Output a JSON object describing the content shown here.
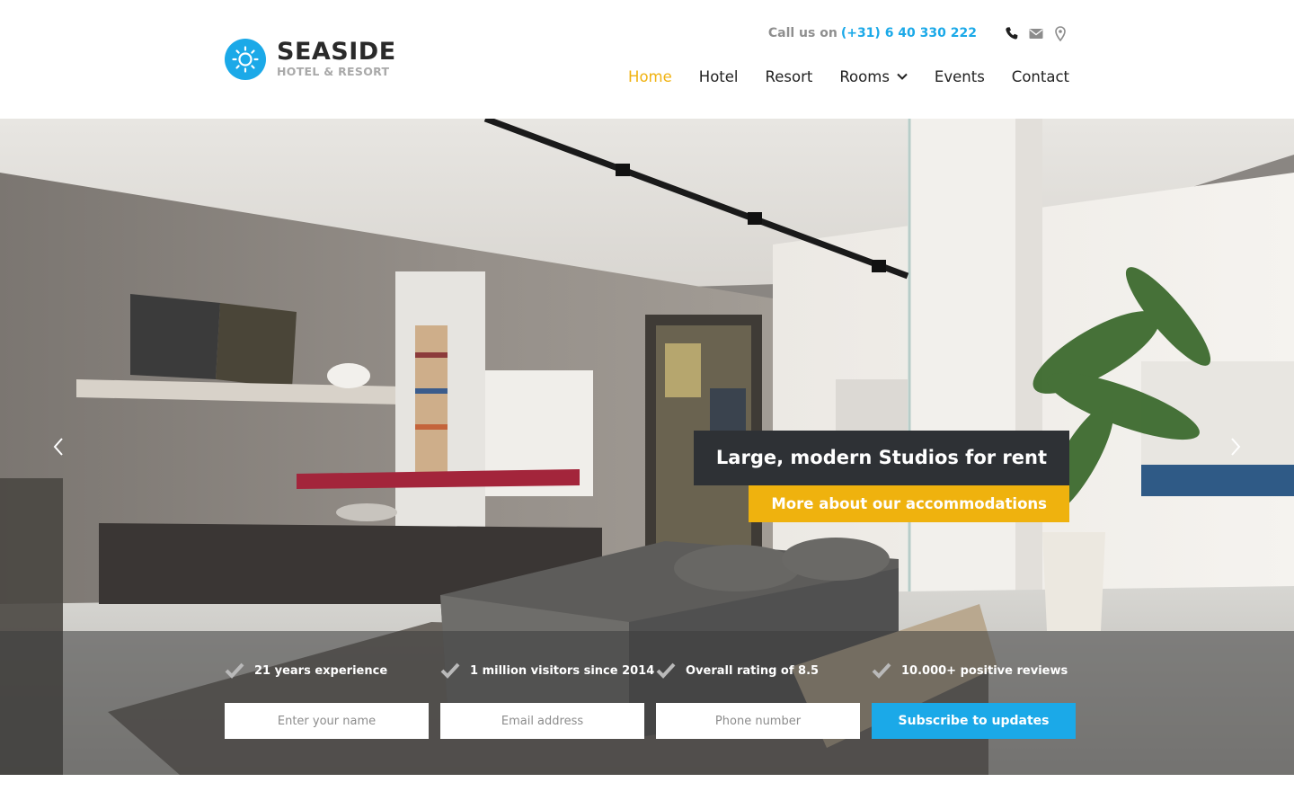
{
  "brand": {
    "name": "SEASIDE",
    "tagline": "HOTEL & RESORT",
    "accent_color": "#1ba9e8",
    "highlight_color": "#f0b210"
  },
  "contact": {
    "label": "Call us on",
    "phone": "(+31) 6 40 330 222",
    "icons": [
      "phone-icon",
      "envelope-icon",
      "map-pin-icon"
    ]
  },
  "nav": {
    "items": [
      {
        "label": "Home",
        "active": true
      },
      {
        "label": "Hotel",
        "active": false
      },
      {
        "label": "Resort",
        "active": false
      },
      {
        "label": "Rooms",
        "active": false,
        "dropdown": true
      },
      {
        "label": "Events",
        "active": false
      },
      {
        "label": "Contact",
        "active": false
      }
    ]
  },
  "hero": {
    "image": "modern studio living room interior",
    "caption_title": "Large, modern Studios for rent",
    "caption_button": "More about our accommodations"
  },
  "features": [
    {
      "text": "21 years experience"
    },
    {
      "text": "1 million visitors since 2014"
    },
    {
      "text": "Overall rating of 8.5"
    },
    {
      "text": "10.000+ positive reviews"
    }
  ],
  "form": {
    "name_placeholder": "Enter your name",
    "email_placeholder": "Email address",
    "phone_placeholder": "Phone number",
    "submit_label": "Subscribe to updates"
  }
}
